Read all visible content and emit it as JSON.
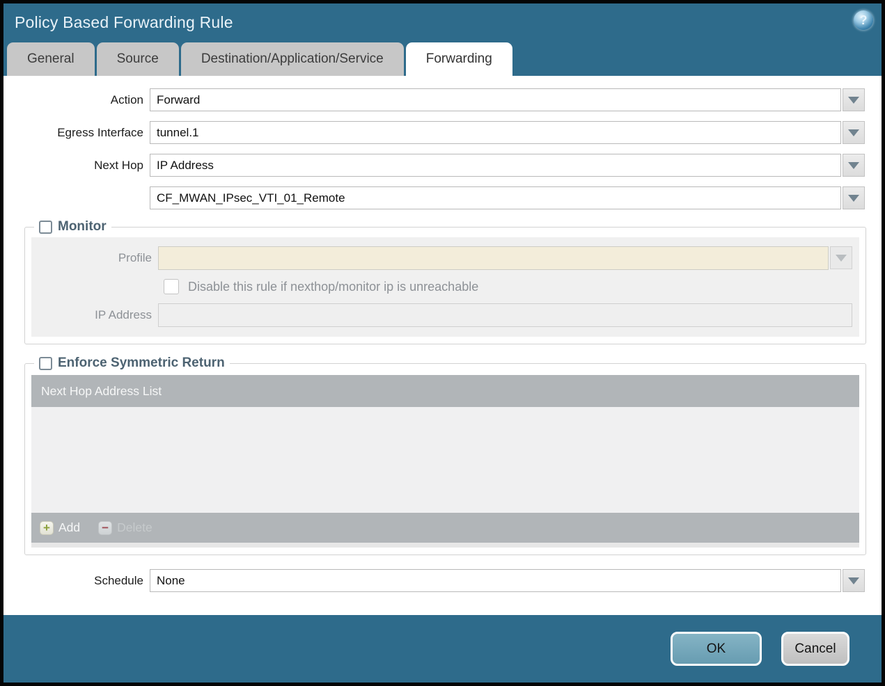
{
  "window": {
    "title": "Policy Based Forwarding Rule",
    "help_icon": "question-mark-circle"
  },
  "tabs": [
    {
      "label": "General",
      "active": false
    },
    {
      "label": "Source",
      "active": false
    },
    {
      "label": "Destination/Application/Service",
      "active": false
    },
    {
      "label": "Forwarding",
      "active": true
    }
  ],
  "form": {
    "action": {
      "label": "Action",
      "value": "Forward"
    },
    "egress_interface": {
      "label": "Egress Interface",
      "value": "tunnel.1"
    },
    "next_hop": {
      "label": "Next Hop",
      "value": "IP Address"
    },
    "next_hop_address": {
      "value": "CF_MWAN_IPsec_VTI_01_Remote"
    },
    "schedule": {
      "label": "Schedule",
      "value": "None"
    }
  },
  "monitor": {
    "legend": "Monitor",
    "checked": false,
    "profile": {
      "label": "Profile",
      "value": ""
    },
    "disable_rule": {
      "label": "Disable this rule if nexthop/monitor ip is unreachable",
      "checked": false
    },
    "ip_address": {
      "label": "IP Address",
      "value": ""
    }
  },
  "symmetric_return": {
    "legend": "Enforce Symmetric Return",
    "checked": false,
    "table": {
      "header": "Next Hop Address List",
      "rows": []
    },
    "add_label": "Add",
    "delete_label": "Delete",
    "delete_enabled": false
  },
  "footer": {
    "ok_label": "OK",
    "cancel_label": "Cancel"
  },
  "colors": {
    "titlebar_teal": "#2e6b8b",
    "inactive_tab_gray": "#c7c7c7",
    "table_header_gray": "#b1b5b8",
    "disabled_field_beige": "#f3edda",
    "panel_gray": "#f0f0f0",
    "ok_button_blue": "#74a6b9",
    "cancel_button_gray": "#c9c9c9",
    "legend_slate": "#4d6372",
    "add_plus_green": "#8ba13c",
    "delete_minus_red": "#9e4c54"
  }
}
